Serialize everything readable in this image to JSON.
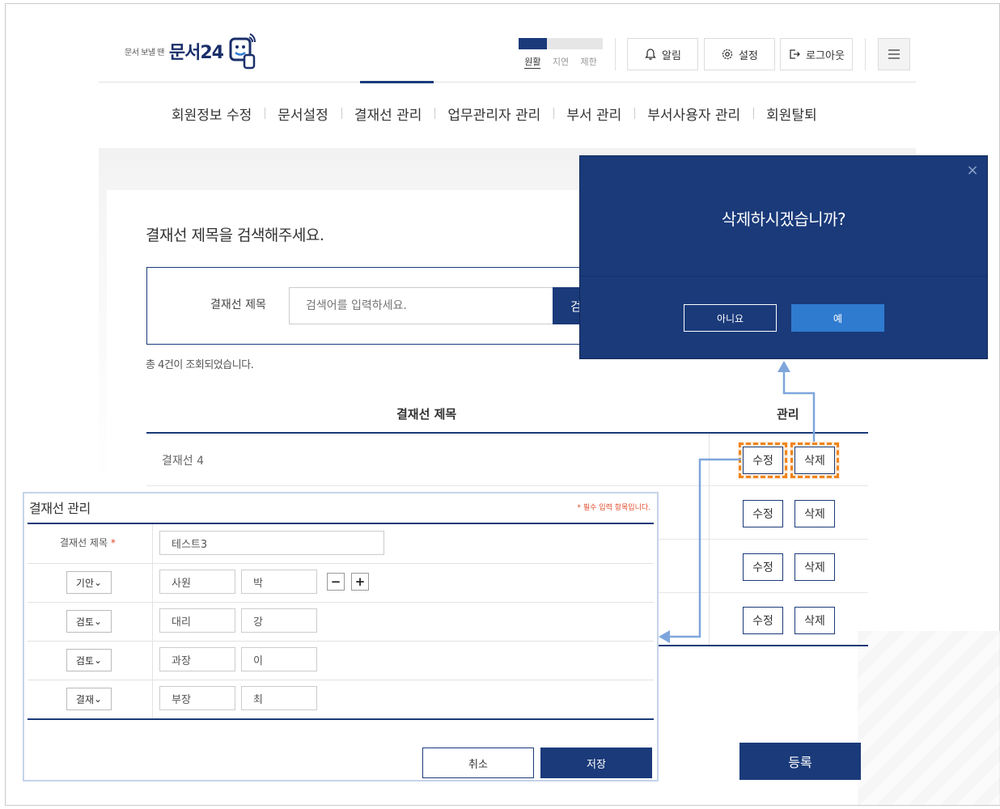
{
  "header": {
    "logo_small": "문서 보낼 땐",
    "logo_main": "문서24",
    "status": [
      {
        "label": "원활",
        "active": true
      },
      {
        "label": "지연",
        "active": false
      },
      {
        "label": "제한",
        "active": false
      }
    ],
    "alarm_label": "알림",
    "settings_label": "설정",
    "logout_label": "로그아웃"
  },
  "nav": {
    "items": [
      "회원정보 수정",
      "문서설정",
      "결재선 관리",
      "업무관리자 관리",
      "부서 관리",
      "부서사용자 관리",
      "회원탈퇴"
    ],
    "active_index": 2
  },
  "search": {
    "heading": "결재선 제목을 검색해주세요.",
    "label": "결재선 제목",
    "placeholder": "검색어를 입력하세요.",
    "button_label": "검",
    "result_count": "총 4건이 조회되었습니다."
  },
  "table": {
    "col_title": "결재선 제목",
    "col_manage": "관리",
    "rows": [
      {
        "title": "결재선 4"
      }
    ],
    "edit_label": "수정",
    "delete_label": "삭제"
  },
  "register_label": "등록",
  "modal": {
    "question": "삭제하시겠습니까?",
    "no_label": "아니요",
    "yes_label": "예",
    "close_icon": "×"
  },
  "edit_panel": {
    "title": "결재선 관리",
    "required_note": "* 필수 입력 항목입니다.",
    "field_label": "결재선 제목",
    "required_mark": "*",
    "title_value": "테스트3",
    "lines": [
      {
        "type": "기안",
        "position": "사원",
        "name": "박"
      },
      {
        "type": "검토",
        "position": "대리",
        "name": "강"
      },
      {
        "type": "검토",
        "position": "과장",
        "name": "이"
      },
      {
        "type": "결재",
        "position": "부장",
        "name": "최"
      }
    ],
    "minus_label": "−",
    "plus_label": "+",
    "cancel_label": "취소",
    "save_label": "저장"
  },
  "colors": {
    "primary": "#1a3a7a",
    "accent_blue": "#2f7bd0",
    "highlight": "#f0841b",
    "connector": "#7ea6dc"
  }
}
